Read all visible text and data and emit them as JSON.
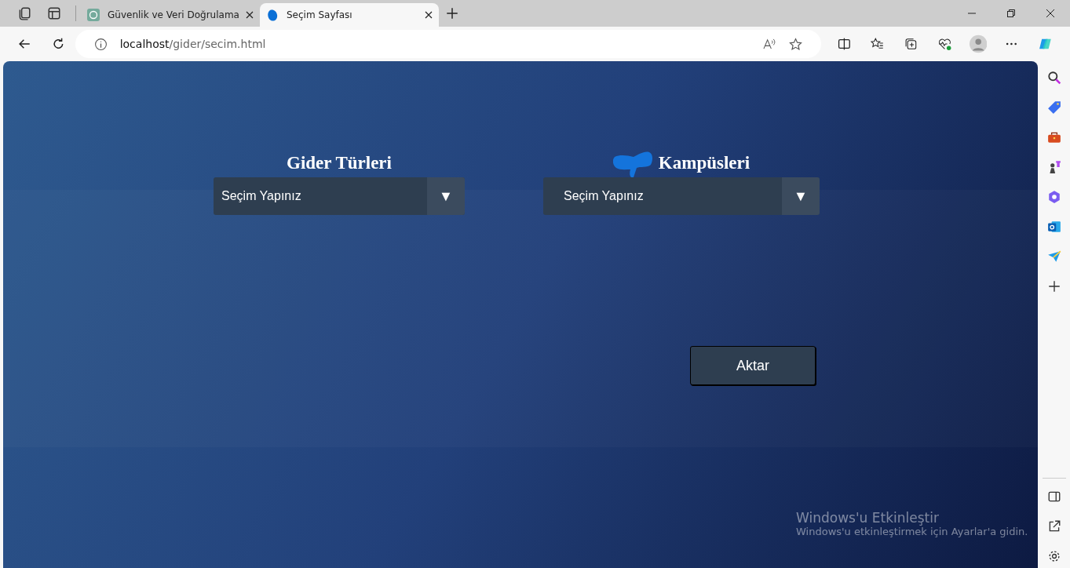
{
  "browser": {
    "tabs": [
      {
        "title": "Güvenlik ve Veri Doğrulama",
        "kind": "gpt",
        "selected": false
      },
      {
        "title": "Seçim Sayfası",
        "kind": "blob",
        "selected": true
      }
    ],
    "address": {
      "host": "localhost",
      "path": "/gider/secim.html"
    }
  },
  "page": {
    "fields": [
      {
        "label": "Gider Türleri",
        "kind": "plain",
        "value": "Seçim Yapınız",
        "arrow": "▼"
      },
      {
        "label": "Kampüsleri",
        "kind": "scribbled",
        "value": "Seçim Yapınız",
        "arrow": "▼"
      }
    ],
    "button": "Aktar"
  },
  "activation": {
    "title": "Windows'u Etkinleştir",
    "text": "Windows'u etkinleştirmek için Ayarlar'a gidin."
  }
}
